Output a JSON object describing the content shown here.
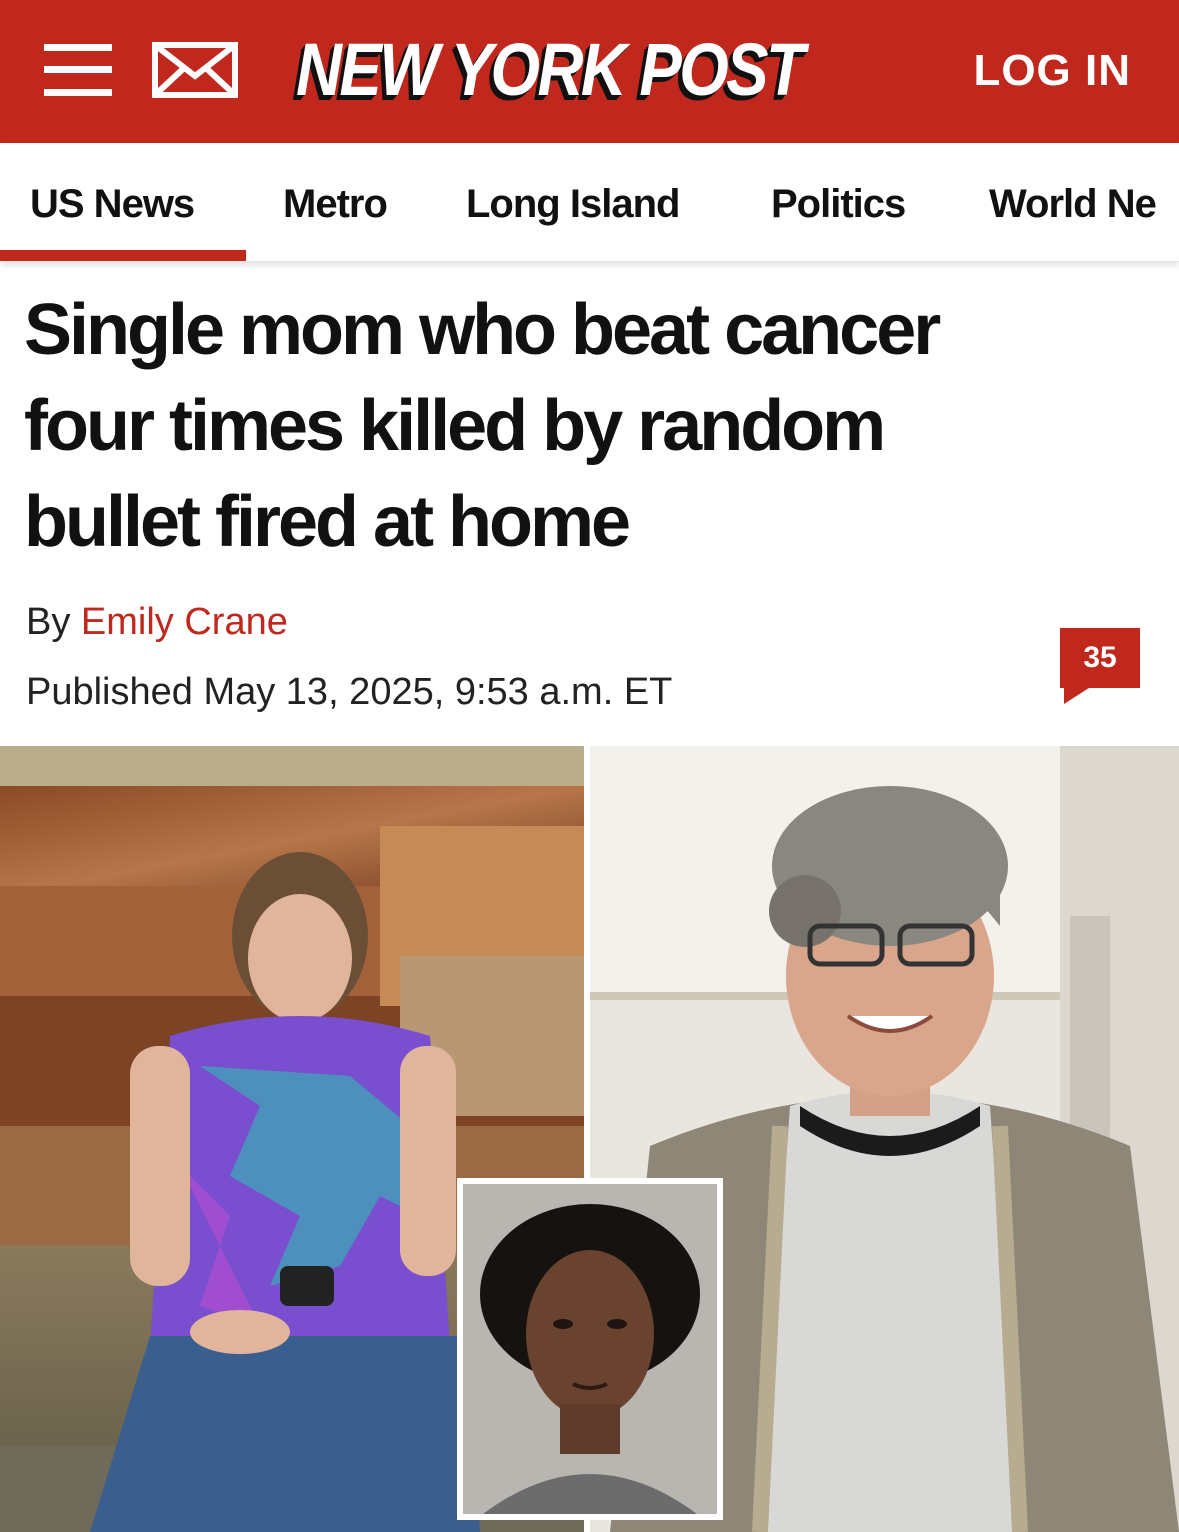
{
  "header": {
    "menu_icon": "hamburger-menu-icon",
    "mail_icon": "envelope-icon",
    "brand": "NEW YORK POST",
    "login_label": "LOG IN",
    "brand_color": "#c0271d"
  },
  "nav": {
    "items": [
      "US News",
      "Metro",
      "Long Island",
      "Politics",
      "World Ne"
    ],
    "active": "US News"
  },
  "article": {
    "headline_lines": [
      "Single mom who beat cancer",
      "four times killed by random",
      "bullet fired at home"
    ],
    "byline_prefix": "By",
    "author": "Emily Crane",
    "published": "Published May 13, 2025, 9:53 a.m. ET",
    "comment_count": "35"
  },
  "images": {
    "left_photo": "woman-sitting-by-waterfall-photo",
    "right_photo": "woman-in-knit-cap-photo",
    "inset_photo": "mugshot-photo"
  }
}
